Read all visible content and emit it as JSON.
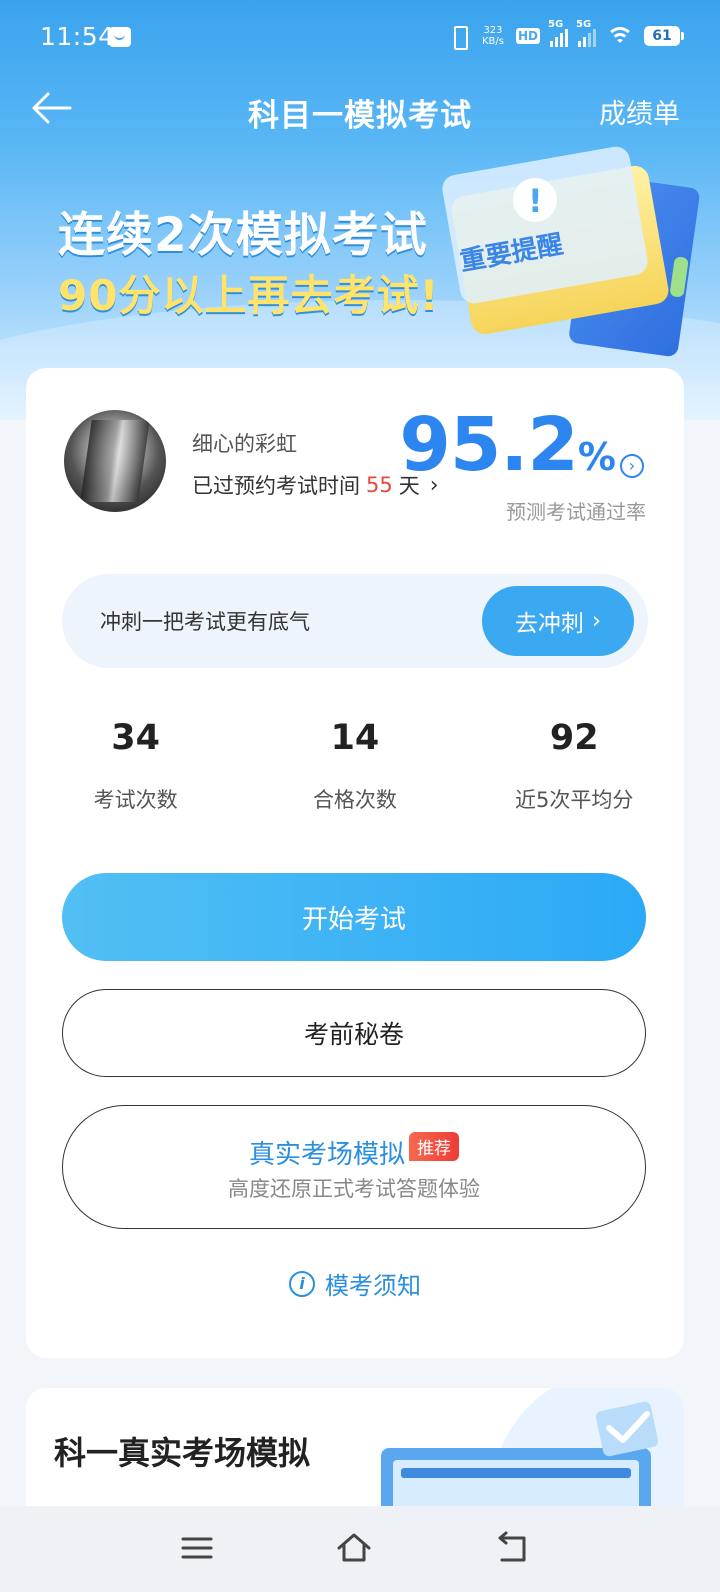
{
  "status_bar": {
    "time": "11:54",
    "net_speed_value": "323",
    "net_speed_unit": "KB/s",
    "hd_label": "HD",
    "sim1_label": "5G",
    "sim2_label": "5G",
    "battery": "61"
  },
  "nav": {
    "title": "科目一模拟考试",
    "right_label": "成绩单"
  },
  "hero": {
    "line1": "连续2次模拟考试",
    "line2": "90分以上再去考试!",
    "illustration_text": "重要提醒"
  },
  "profile": {
    "username": "细心的彩虹",
    "days_prefix": "已过预约考试时间",
    "days_value": "55",
    "days_suffix": "天"
  },
  "pass_rate": {
    "value": "95.2",
    "unit": "%",
    "label": "预测考试通过率"
  },
  "sprint": {
    "text": "冲刺一把考试更有底气",
    "button": "去冲刺"
  },
  "stats": [
    {
      "value": "34",
      "label": "考试次数"
    },
    {
      "value": "14",
      "label": "合格次数"
    },
    {
      "value": "92",
      "label": "近5次平均分"
    }
  ],
  "buttons": {
    "start": "开始考试",
    "secret": "考前秘卷",
    "real_title": "真实考场模拟",
    "real_badge": "推荐",
    "real_sub": "高度还原正式考试答题体验"
  },
  "notice": {
    "label": "模考须知"
  },
  "second_card": {
    "title": "科一真实考场模拟"
  },
  "colors": {
    "accent_blue": "#2d86f0",
    "button_blue": "#3ba8f2",
    "highlight_red": "#e24a3b",
    "hero_yellow": "#ffe36b"
  }
}
